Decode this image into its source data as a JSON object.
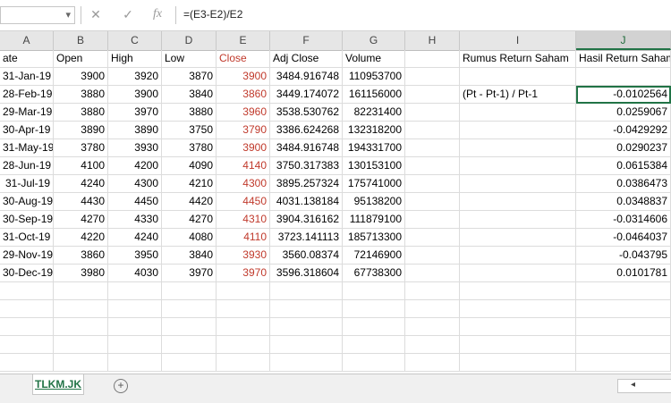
{
  "formula_bar": {
    "cancel_icon": "✕",
    "enter_icon": "✓",
    "fx_label": "fx",
    "formula": "=(E3-E2)/E2"
  },
  "columns": [
    "A",
    "B",
    "C",
    "D",
    "E",
    "F",
    "G",
    "H",
    "I",
    "J"
  ],
  "selected_column": "J",
  "header_row": {
    "A": "ate",
    "B": "Open",
    "C": "High",
    "D": "Low",
    "E": "Close",
    "F": "Adj Close",
    "G": "Volume",
    "I": "Rumus Return Saham",
    "J": "Hasil Return Saham"
  },
  "rows": [
    {
      "date": "31-Jan-19",
      "open": "3900",
      "high": "3920",
      "low": "3870",
      "close": "3900",
      "adj": "3484.916748",
      "vol": "110953700",
      "formula": "",
      "ret": ""
    },
    {
      "date": "28-Feb-19",
      "open": "3880",
      "high": "3900",
      "low": "3840",
      "close": "3860",
      "adj": "3449.174072",
      "vol": "161156000",
      "formula": "(Pt - Pt-1) / Pt-1",
      "ret": "-0.0102564"
    },
    {
      "date": "29-Mar-19",
      "open": "3880",
      "high": "3970",
      "low": "3880",
      "close": "3960",
      "adj": "3538.530762",
      "vol": "82231400",
      "formula": "",
      "ret": "0.0259067"
    },
    {
      "date": "30-Apr-19",
      "open": "3890",
      "high": "3890",
      "low": "3750",
      "close": "3790",
      "adj": "3386.624268",
      "vol": "132318200",
      "formula": "",
      "ret": "-0.0429292"
    },
    {
      "date": "31-May-19",
      "open": "3780",
      "high": "3930",
      "low": "3780",
      "close": "3900",
      "adj": "3484.916748",
      "vol": "194331700",
      "formula": "",
      "ret": "0.0290237"
    },
    {
      "date": "28-Jun-19",
      "open": "4100",
      "high": "4200",
      "low": "4090",
      "close": "4140",
      "adj": "3750.317383",
      "vol": "130153100",
      "formula": "",
      "ret": "0.0615384"
    },
    {
      "date": "31-Jul-19",
      "open": "4240",
      "high": "4300",
      "low": "4210",
      "close": "4300",
      "adj": "3895.257324",
      "vol": "175741000",
      "formula": "",
      "ret": "0.0386473"
    },
    {
      "date": "30-Aug-19",
      "open": "4430",
      "high": "4450",
      "low": "4420",
      "close": "4450",
      "adj": "4031.138184",
      "vol": "95138200",
      "formula": "",
      "ret": "0.0348837"
    },
    {
      "date": "30-Sep-19",
      "open": "4270",
      "high": "4330",
      "low": "4270",
      "close": "4310",
      "adj": "3904.316162",
      "vol": "111879100",
      "formula": "",
      "ret": "-0.0314606"
    },
    {
      "date": "31-Oct-19",
      "open": "4220",
      "high": "4240",
      "low": "4080",
      "close": "4110",
      "adj": "3723.141113",
      "vol": "185713300",
      "formula": "",
      "ret": "-0.0464037"
    },
    {
      "date": "29-Nov-19",
      "open": "3860",
      "high": "3950",
      "low": "3840",
      "close": "3930",
      "adj": "3560.08374",
      "vol": "72146900",
      "formula": "",
      "ret": "-0.043795"
    },
    {
      "date": "30-Dec-19",
      "open": "3980",
      "high": "4030",
      "low": "3970",
      "close": "3970",
      "adj": "3596.318604",
      "vol": "67738300",
      "formula": "",
      "ret": "0.0101781"
    }
  ],
  "sheet_tab": "TLKM.JK",
  "add_sheet_icon": "+",
  "scroll_arrow": "◂",
  "colors": {
    "accent": "#217346",
    "close_red": "#c0392b"
  }
}
